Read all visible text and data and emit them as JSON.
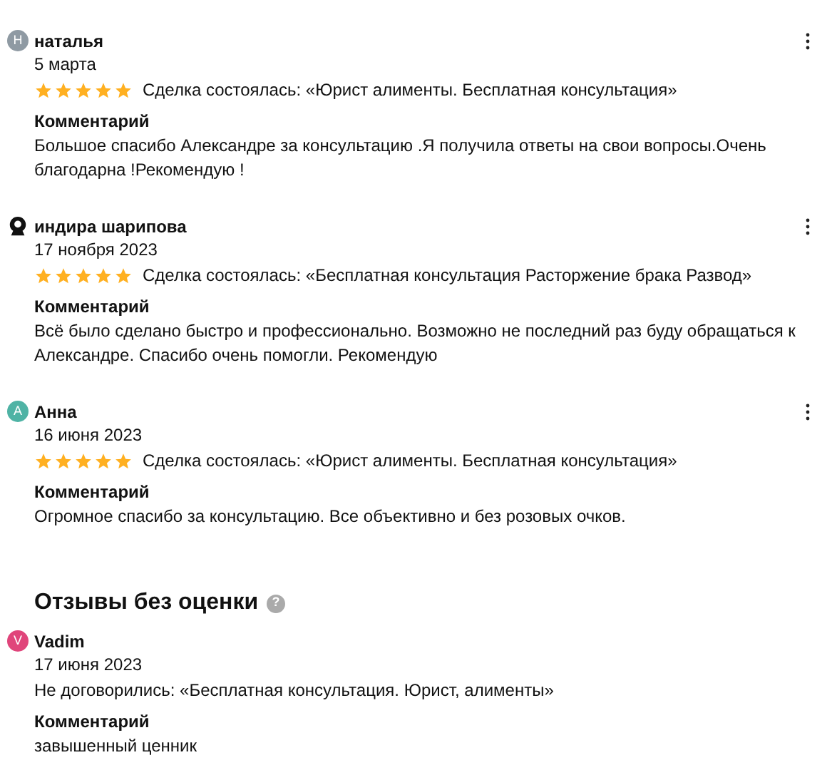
{
  "reviews": [
    {
      "avatar": {
        "kind": "letter",
        "letter": "Н",
        "color": "#8f9aa3"
      },
      "name": "наталья",
      "date": "5 марта",
      "stars": 5,
      "deal": "Сделка состоялась: «Юрист алименты. Бесплатная консультация»",
      "comment_label": "Комментарий",
      "comment": "Большое спасибо Александре за консультацию .Я получила ответы на свои вопросы.Очень благодарна !Рекомендую !",
      "menu": true
    },
    {
      "avatar": {
        "kind": "silhouette"
      },
      "name": "индира шарипова",
      "date": "17 ноября 2023",
      "stars": 5,
      "deal": "Сделка состоялась: «Бесплатная консультация Расторжение брака Развод»",
      "comment_label": "Комментарий",
      "comment": "Всё было сделано быстро и профессионально. Возможно не последний раз буду обращаться к Александре. Спасибо очень помогли. Рекомендую",
      "menu": true
    },
    {
      "avatar": {
        "kind": "letter",
        "letter": "А",
        "color": "#4fb3a5"
      },
      "name": "Анна",
      "date": "16 июня 2023",
      "stars": 5,
      "deal": "Сделка состоялась: «Юрист алименты. Бесплатная консультация»",
      "comment_label": "Комментарий",
      "comment": "Огромное спасибо за консультацию. Все объективно и без розовых очков.",
      "menu": true
    }
  ],
  "unrated": {
    "title": "Отзывы без оценки",
    "help": "?",
    "reviews": [
      {
        "avatar": {
          "kind": "letter",
          "letter": "V",
          "color": "#e0457b"
        },
        "name": "Vadim",
        "date": "17 июня 2023",
        "deal": "Не договорились: «Бесплатная консультация. Юрист, алименты»",
        "comment_label": "Комментарий",
        "comment": "завышенный ценник",
        "menu": false
      }
    ]
  }
}
